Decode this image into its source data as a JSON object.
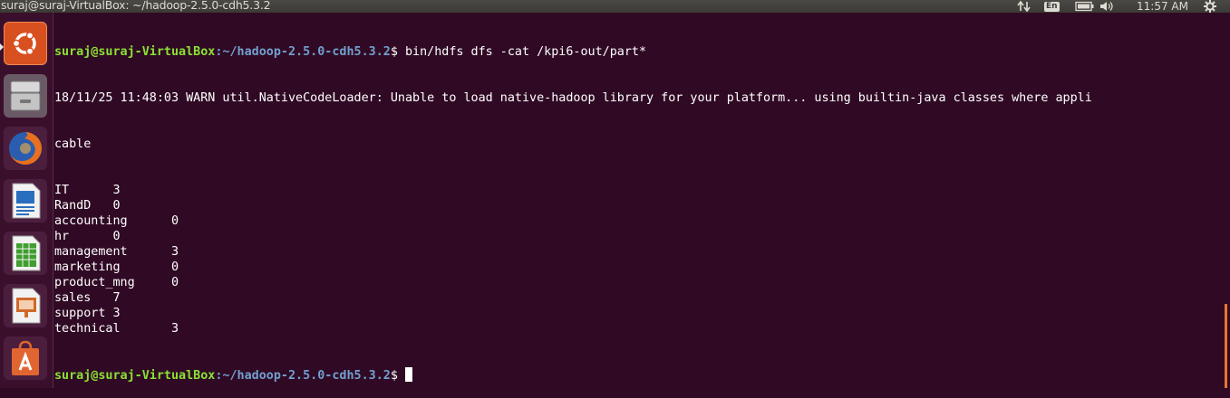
{
  "window_title": "suraj@suraj-VirtualBox: ~/hadoop-2.5.0-cdh5.3.2",
  "indicators": {
    "keyboard": "En",
    "clock": "11:57 AM",
    "network_icon": "network-updown-icon",
    "battery_icon": "battery-icon",
    "sound_icon": "speaker-icon",
    "settings_icon": "gear-icon"
  },
  "launcher": [
    {
      "name": "ubuntu-dash",
      "icon": "ubuntu-logo-icon",
      "color": "#e05a2a"
    },
    {
      "name": "files",
      "icon": "file-cabinet-icon",
      "color": "#8a8a8a"
    },
    {
      "name": "firefox",
      "icon": "firefox-icon",
      "color": "#e06020"
    },
    {
      "name": "libreoffice-writer",
      "icon": "writer-document-icon",
      "color": "#2a6fbd"
    },
    {
      "name": "libreoffice-calc",
      "icon": "calc-spreadsheet-icon",
      "color": "#3f9e2f"
    },
    {
      "name": "libreoffice-impress",
      "icon": "impress-presentation-icon",
      "color": "#d0692a"
    },
    {
      "name": "software-center",
      "icon": "shopping-bag-icon",
      "color": "#e06530"
    }
  ],
  "terminal": {
    "prompt_user": "suraj@suraj-VirtualBox",
    "prompt_path": ":~/hadoop-2.5.0-cdh5.3.2",
    "prompt_symbol": "$ ",
    "command": "bin/hdfs dfs -cat /kpi6-out/part*",
    "warn_line_1": "18/11/25 11:48:03 WARN util.NativeCodeLoader: Unable to load native-hadoop library for your platform... using builtin-java classes where appli",
    "warn_line_2": "cable",
    "output": [
      {
        "key": "IT",
        "value": "3"
      },
      {
        "key": "RandD",
        "value": "0"
      },
      {
        "key": "accounting",
        "value": "0"
      },
      {
        "key": "hr",
        "value": "0"
      },
      {
        "key": "management",
        "value": "3"
      },
      {
        "key": "marketing",
        "value": "0"
      },
      {
        "key": "product_mng",
        "value": "0"
      },
      {
        "key": "sales",
        "value": "7"
      },
      {
        "key": "support",
        "value": "3"
      },
      {
        "key": "technical",
        "value": "3"
      }
    ]
  }
}
